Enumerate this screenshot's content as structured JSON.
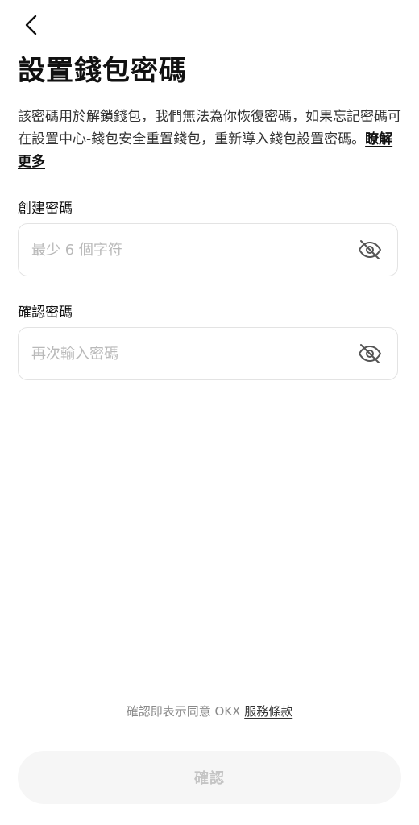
{
  "header": {
    "back_icon": "chevron-left-icon",
    "title": "設置錢包密碼"
  },
  "description": {
    "text": "該密碼用於解鎖錢包，我們無法為你恢復密碼，如果忘記密碼可在設置中心-錢包安全重置錢包，重新導入錢包設置密碼。",
    "learn_more": "瞭解更多"
  },
  "fields": {
    "create": {
      "label": "創建密碼",
      "value": "",
      "placeholder": "最少 6 個字符",
      "toggle_icon": "eye-off-icon"
    },
    "confirm": {
      "label": "確認密碼",
      "value": "",
      "placeholder": "再次輸入密碼",
      "toggle_icon": "eye-off-icon"
    }
  },
  "footer": {
    "terms_prefix": "確認即表示同意 OKX ",
    "terms_link": "服務條款",
    "confirm_label": "確認"
  },
  "colors": {
    "text_primary": "#111111",
    "text_secondary": "#333333",
    "placeholder": "#b9b9b9",
    "border": "#e3e3e3",
    "button_bg_disabled": "#f6f6f6",
    "button_text_disabled": "#c4c4c4"
  }
}
